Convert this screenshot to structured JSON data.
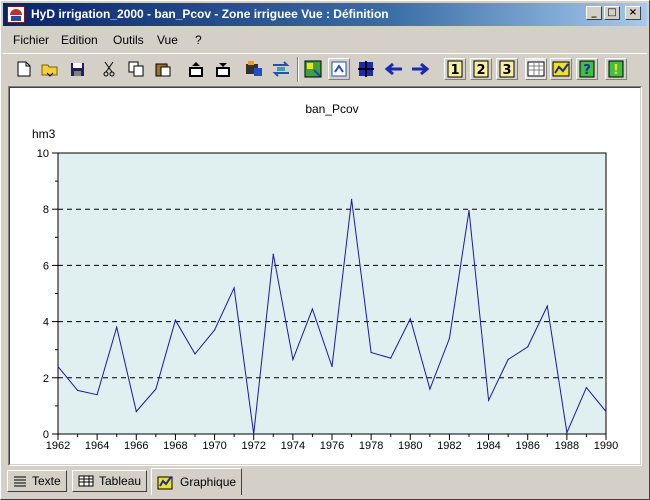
{
  "window": {
    "title": "HyD irrigation_2000 - ban_Pcov - Zone irriguee Vue : Définition",
    "minimize_label": "_",
    "maximize_label": "□",
    "close_label": "×"
  },
  "menu": [
    "Fichier",
    "Edition",
    "Outils",
    "Vue",
    "?"
  ],
  "toolbar_icons": [
    "new-file-icon",
    "open-folder-icon",
    "save-icon",
    "cut-icon",
    "copy-icon",
    "paste-icon",
    "export-icon",
    "import-icon",
    "compute-icon",
    "swap-icon",
    "grid-green-icon",
    "fit-icon",
    "select-icon",
    "arrow-left-icon",
    "arrow-right-icon",
    "view-1-icon",
    "view-2-icon",
    "view-3-icon",
    "table-view-icon",
    "chart-view-icon",
    "help-icon",
    "info-icon"
  ],
  "colors": {
    "plot_bg": "#e0eff0",
    "line": "#1a1aa0",
    "grid": "#000000",
    "accent": "#0a246a"
  },
  "tabs": [
    {
      "label": "Texte",
      "icon": "text-list-icon"
    },
    {
      "label": "Tableau",
      "icon": "table-icon"
    },
    {
      "label": "Graphique",
      "icon": "chart-icon",
      "active": true
    }
  ],
  "chart_data": {
    "type": "line",
    "title": "ban_Pcov",
    "ylabel": "hm3",
    "xlabel": "",
    "xlim": [
      1962,
      1990
    ],
    "ylim": [
      0,
      10
    ],
    "yticks": [
      0,
      2,
      4,
      6,
      8,
      10
    ],
    "xticks": [
      1962,
      1964,
      1966,
      1968,
      1970,
      1972,
      1974,
      1976,
      1978,
      1980,
      1982,
      1984,
      1986,
      1988,
      1990
    ],
    "grid": "horizontal dashed",
    "x": [
      1962,
      1963,
      1964,
      1965,
      1966,
      1967,
      1968,
      1969,
      1970,
      1971,
      1972,
      1973,
      1974,
      1975,
      1976,
      1977,
      1978,
      1979,
      1980,
      1981,
      1982,
      1983,
      1984,
      1985,
      1986,
      1987,
      1988,
      1989,
      1990
    ],
    "values": [
      2.4,
      1.55,
      1.4,
      3.8,
      0.8,
      1.6,
      4.05,
      2.85,
      3.7,
      5.2,
      0.0,
      6.4,
      2.65,
      4.45,
      2.4,
      8.35,
      2.9,
      2.7,
      4.1,
      1.6,
      3.4,
      7.95,
      1.2,
      2.65,
      3.1,
      4.55,
      0.05,
      1.65,
      0.8
    ]
  }
}
